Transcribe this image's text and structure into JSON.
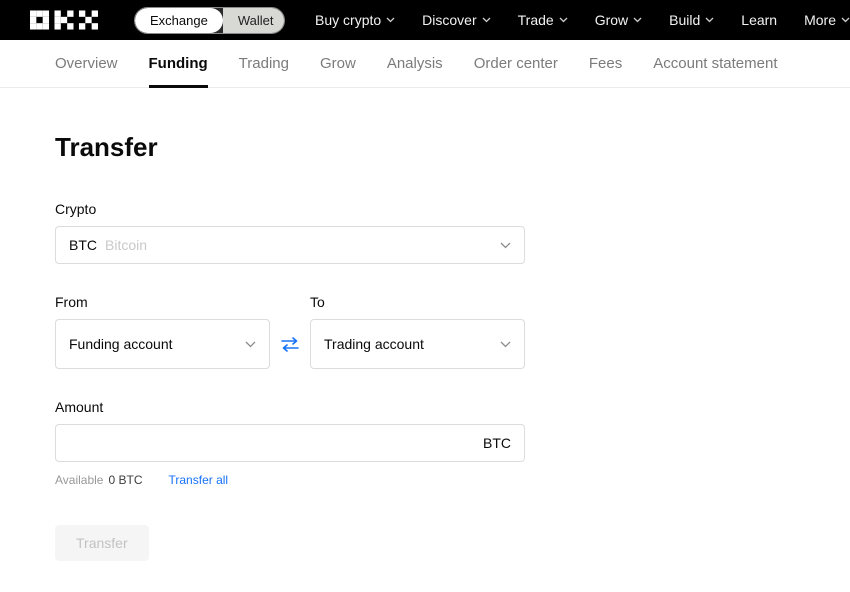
{
  "header": {
    "logo_alt": "OKX",
    "toggle": {
      "exchange": "Exchange",
      "wallet": "Wallet"
    },
    "nav": [
      "Buy crypto",
      "Discover",
      "Trade",
      "Grow",
      "Build",
      "Learn",
      "More"
    ]
  },
  "tabs": [
    "Overview",
    "Funding",
    "Trading",
    "Grow",
    "Analysis",
    "Order center",
    "Fees",
    "Account statement"
  ],
  "active_tab": "Funding",
  "content": {
    "title": "Transfer",
    "crypto": {
      "label": "Crypto",
      "symbol": "BTC",
      "name": "Bitcoin"
    },
    "from": {
      "label": "From",
      "value": "Funding account"
    },
    "to": {
      "label": "To",
      "value": "Trading account"
    },
    "amount": {
      "label": "Amount",
      "value": "",
      "suffix": "BTC"
    },
    "available": {
      "label": "Available",
      "value": "0 BTC",
      "transfer_all": "Transfer all"
    },
    "submit_label": "Transfer"
  },
  "colors": {
    "accent_blue": "#1772f8",
    "header_bg": "#000000"
  }
}
